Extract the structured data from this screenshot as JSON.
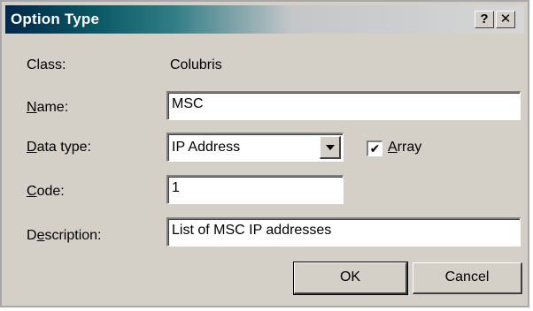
{
  "window": {
    "title": "Option Type",
    "help_label": "?",
    "close_label": "✕"
  },
  "form": {
    "class_label": "Class:",
    "class_value": "Colubris",
    "name_label": "Name:",
    "name_value": "MSC",
    "datatype_label": "Data type:",
    "datatype_value": "IP Address",
    "array_label": "Array",
    "array_checked": true,
    "code_label": "Code:",
    "code_value": "1",
    "description_label": "Description:",
    "description_value": "List of MSC IP addresses"
  },
  "buttons": {
    "ok_label": "OK",
    "cancel_label": "Cancel"
  },
  "icons": {
    "check_mark": "✔"
  }
}
